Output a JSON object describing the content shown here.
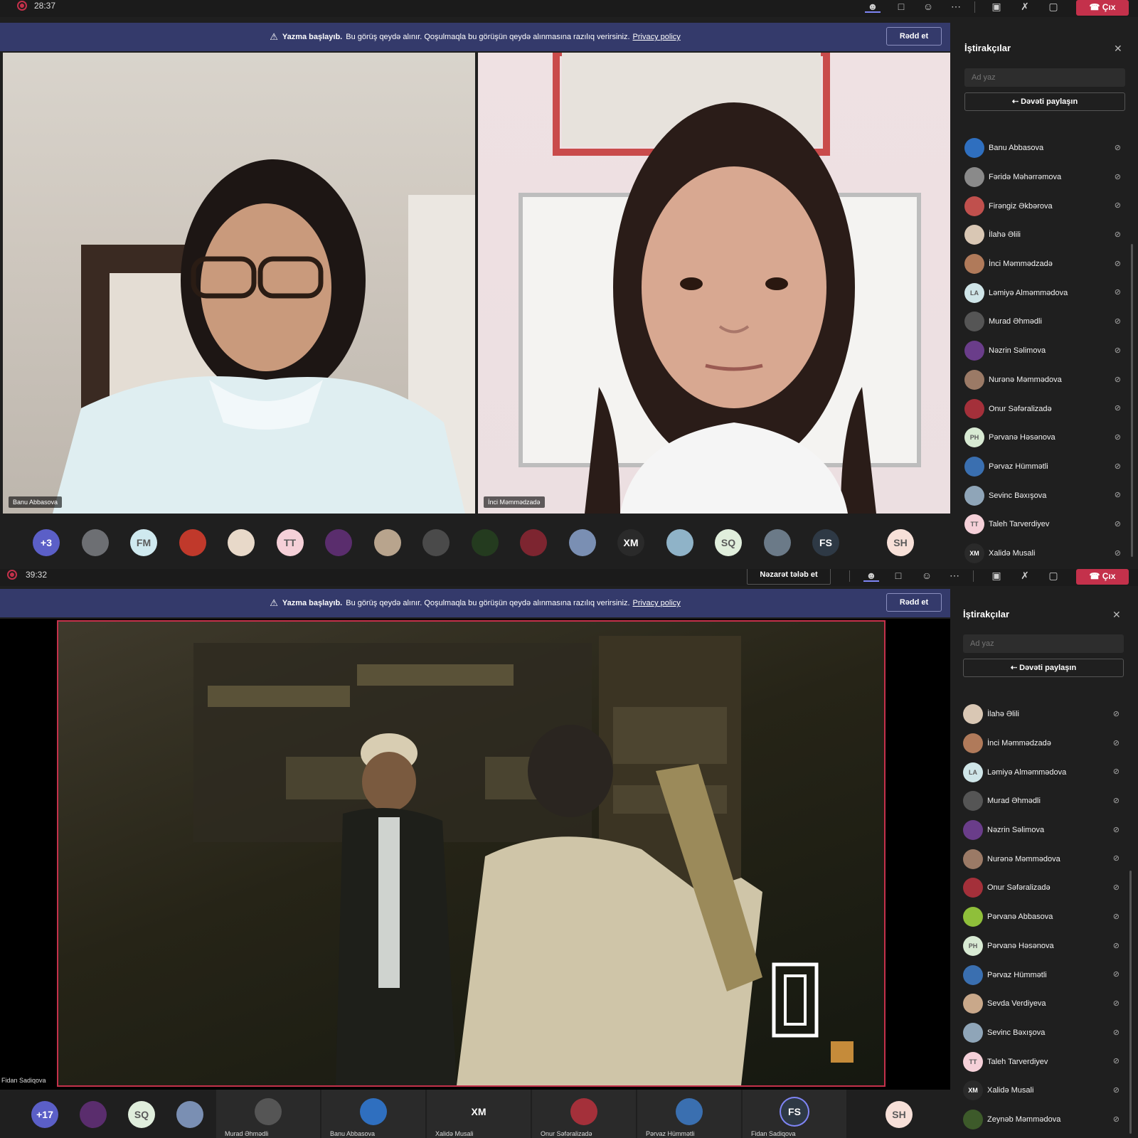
{
  "top": {
    "timer": "28:37",
    "banner": {
      "title": "Yazma başlayıb.",
      "message": "Bu görüş qeydə alınır. Qoşulmaqla bu görüşün qeydə alınmasına razılıq verirsiniz.",
      "link": "Privacy policy",
      "dismiss": "Rədd et"
    },
    "leave_label": "Çıx",
    "sidebar": {
      "title": "İştirakçılar",
      "search_placeholder": "Ad yaz",
      "share_label": "Dəvəti paylaşın",
      "participants": [
        {
          "name": "Banu Abbasova",
          "color": "#2f6fbf",
          "initials": ""
        },
        {
          "name": "Fəridə Məhərrəmova",
          "color": "#8a8a8a",
          "initials": ""
        },
        {
          "name": "Firəngiz Əkbərova",
          "color": "#c0504d",
          "initials": ""
        },
        {
          "name": "İlahə Əlili",
          "color": "#d9c7b4",
          "initials": ""
        },
        {
          "name": "İnci Məmmədzadə",
          "color": "#b07a5a",
          "initials": ""
        },
        {
          "name": "Ləmiyə Alməmmədova",
          "color": "#cfe5e8",
          "initials": "LA"
        },
        {
          "name": "Murad Əhmədli",
          "color": "#555555",
          "initials": ""
        },
        {
          "name": "Nəzrin Səlimova",
          "color": "#6a3d8a",
          "initials": ""
        },
        {
          "name": "Nurənə Məmmədova",
          "color": "#9b7a66",
          "initials": ""
        },
        {
          "name": "Onur Səfəralizadə",
          "color": "#a4303a",
          "initials": ""
        },
        {
          "name": "Pərvanə Həsənova",
          "color": "#d8ead3",
          "initials": "PH"
        },
        {
          "name": "Pərvaz Hümmətli",
          "color": "#3a6fb0",
          "initials": ""
        },
        {
          "name": "Sevinc Bəxışova",
          "color": "#8fa5b8",
          "initials": ""
        },
        {
          "name": "Taleh Tarverdiyev",
          "color": "#f5d0d8",
          "initials": "TT"
        },
        {
          "name": "Xalidə Musali",
          "color": "#2a2a2a",
          "initials": "XM"
        }
      ]
    },
    "tiles": [
      {
        "name": "Banu Abbasova"
      },
      {
        "name": "İnci Məmmədzadə"
      }
    ],
    "strip": [
      {
        "initials": "+3",
        "color": "#5b5fc7"
      },
      {
        "initials": "",
        "color": "#6d6f73"
      },
      {
        "initials": "FM",
        "color": "#cfe9ef"
      },
      {
        "initials": "",
        "color": "#c0392b"
      },
      {
        "initials": "",
        "color": "#e8d9c9"
      },
      {
        "initials": "TT",
        "color": "#f5d0d8"
      },
      {
        "initials": "",
        "color": "#5a2d6d"
      },
      {
        "initials": "",
        "color": "#b8a48d"
      },
      {
        "initials": "",
        "color": "#4a4a4a"
      },
      {
        "initials": "",
        "color": "#243b1f"
      },
      {
        "initials": "",
        "color": "#7d2530"
      },
      {
        "initials": "",
        "color": "#7a8fb3"
      },
      {
        "initials": "XM",
        "color": "#2a2a2a"
      },
      {
        "initials": "",
        "color": "#8fb3c8"
      },
      {
        "initials": "SQ",
        "color": "#e0eedc"
      },
      {
        "initials": "",
        "color": "#6b7a88"
      },
      {
        "initials": "FS",
        "color": "#2e3945"
      },
      {
        "initials": "SH",
        "color": "#f7e0d8"
      }
    ]
  },
  "bottom": {
    "timer": "39:32",
    "control_request": "Nəzarət tələb et",
    "banner": {
      "title": "Yazma başlayıb.",
      "message": "Bu görüş qeydə alınır. Qoşulmaqla bu görüşün qeydə alınmasına razılıq verirsiniz.",
      "link": "Privacy policy",
      "dismiss": "Rədd et"
    },
    "leave_label": "Çıx",
    "presenter_label": "Fidan Sadiqova",
    "sidebar": {
      "title": "İştirakçılar",
      "search_placeholder": "Ad yaz",
      "share_label": "Dəvəti paylaşın",
      "participants": [
        {
          "name": "İlahə Əlili",
          "color": "#d9c7b4",
          "initials": ""
        },
        {
          "name": "İnci Məmmədzadə",
          "color": "#b07a5a",
          "initials": ""
        },
        {
          "name": "Ləmiyə Alməmmədova",
          "color": "#cfe5e8",
          "initials": "LA"
        },
        {
          "name": "Murad Əhmədli",
          "color": "#555555",
          "initials": ""
        },
        {
          "name": "Nəzrin Səlimova",
          "color": "#6a3d8a",
          "initials": ""
        },
        {
          "name": "Nurənə Məmmədova",
          "color": "#9b7a66",
          "initials": ""
        },
        {
          "name": "Onur Səfəralizadə",
          "color": "#a4303a",
          "initials": ""
        },
        {
          "name": "Pərvanə Abbasova",
          "color": "#8fbf3a",
          "initials": ""
        },
        {
          "name": "Pərvanə Həsənova",
          "color": "#d8ead3",
          "initials": "PH"
        },
        {
          "name": "Pərvaz Hümmətli",
          "color": "#3a6fb0",
          "initials": ""
        },
        {
          "name": "Sevda Verdiyeva",
          "color": "#c9a88a",
          "initials": ""
        },
        {
          "name": "Sevinc Bəxışova",
          "color": "#8fa5b8",
          "initials": ""
        },
        {
          "name": "Taleh Tarverdiyev",
          "color": "#f5d0d8",
          "initials": "TT"
        },
        {
          "name": "Xalidə Musali",
          "color": "#2a2a2a",
          "initials": "XM"
        },
        {
          "name": "Zeynəb Məmmədova",
          "color": "#3d5a2a",
          "initials": ""
        }
      ]
    },
    "strip": [
      {
        "initials": "+17",
        "color": "#5b5fc7"
      },
      {
        "initials": "",
        "color": "#5a2d6d"
      },
      {
        "initials": "SQ",
        "color": "#e0eedc"
      },
      {
        "initials": "",
        "color": "#7a8fb3"
      }
    ],
    "strip_tiles": [
      {
        "name": "Murad Əhmədli",
        "initials": "",
        "color": "#555555"
      },
      {
        "name": "Banu Abbasova",
        "initials": "",
        "color": "#2f6fbf"
      },
      {
        "name": "Xalidə Musali",
        "initials": "XM",
        "color": "#2a2a2a"
      },
      {
        "name": "Onur Səfəralizadə",
        "initials": "",
        "color": "#a4303a"
      },
      {
        "name": "Pərvaz Hümmətli",
        "initials": "",
        "color": "#3a6fb0"
      },
      {
        "name": "Fidan Sadiqova",
        "initials": "FS",
        "color": "#2e3945"
      }
    ],
    "strip_end": {
      "initials": "SH",
      "color": "#f7e0d8"
    }
  }
}
